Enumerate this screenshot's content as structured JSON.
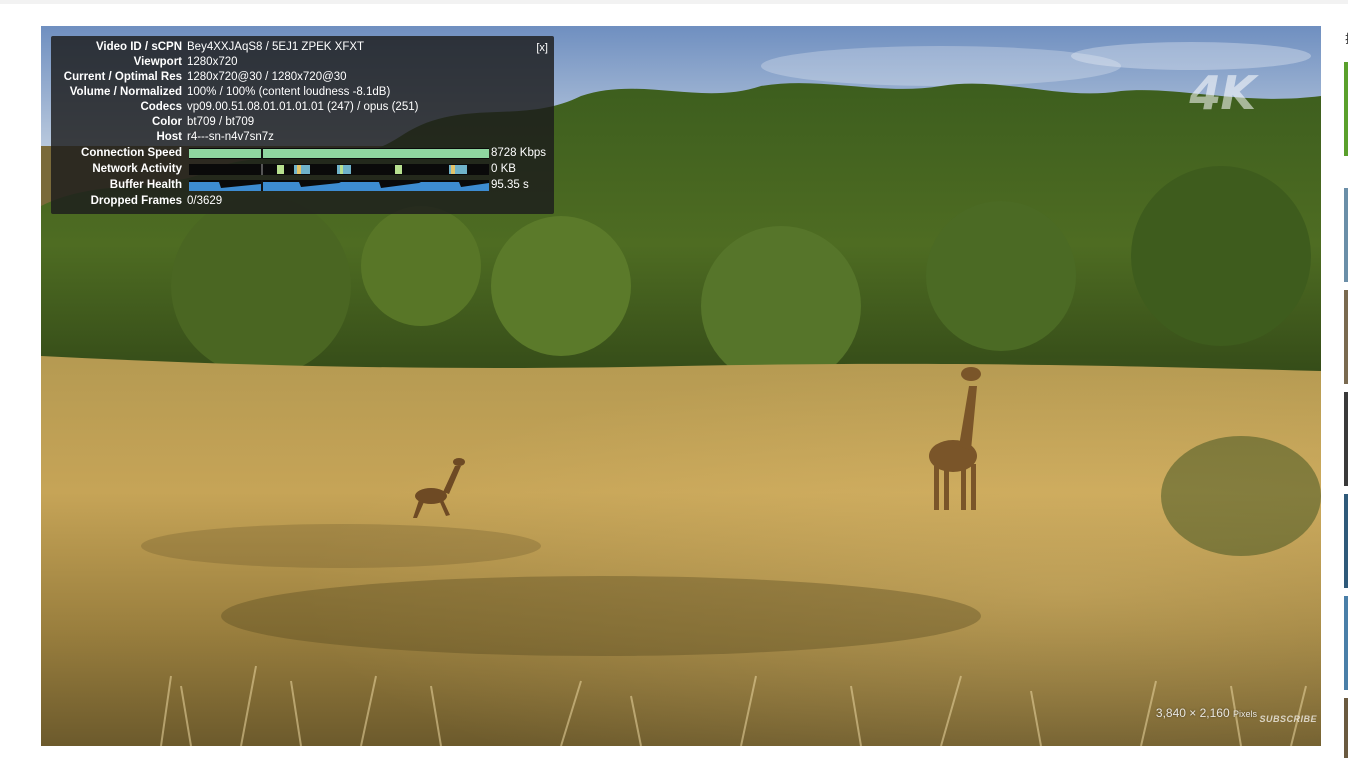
{
  "player": {
    "watermark_4k": "4K",
    "resolution_badge": "3,840 × 2,160",
    "resolution_unit": "Pixels",
    "subscribe_watermark": "SUBSCRIBE"
  },
  "stats": {
    "close_label": "[x]",
    "rows": [
      {
        "label": "Video ID / sCPN",
        "value": "Bey4XXJAqS8 / 5EJ1 ZPEK XFXT"
      },
      {
        "label": "Viewport",
        "value": "1280x720"
      },
      {
        "label": "Current / Optimal Res",
        "value": "1280x720@30 / 1280x720@30"
      },
      {
        "label": "Volume / Normalized",
        "value": "100% / 100% (content loudness -8.1dB)"
      },
      {
        "label": "Codecs",
        "value": "vp09.00.51.08.01.01.01.01 (247) / opus (251)"
      },
      {
        "label": "Color",
        "value": "bt709 / bt709"
      },
      {
        "label": "Host",
        "value": "r4---sn-n4v7sn7z"
      }
    ],
    "connection_speed": {
      "label": "Connection Speed",
      "value": "8728 Kbps",
      "color": "#8fd6a0"
    },
    "network_activity": {
      "label": "Network Activity",
      "value": "0 KB",
      "color": "#6fb3c9"
    },
    "buffer_health": {
      "label": "Buffer Health",
      "value": "95.35 s",
      "color": "#3d8cd1"
    },
    "dropped_frames": {
      "label": "Dropped Frames",
      "value": "0/3629"
    }
  },
  "sidebar": {
    "partial_char": "排"
  }
}
